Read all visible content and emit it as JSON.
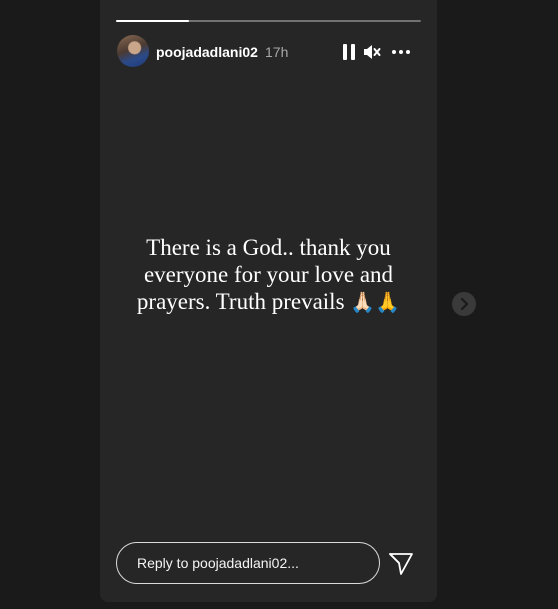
{
  "story": {
    "progress": 0.24,
    "username": "poojadadlani02",
    "timestamp": "17h",
    "text_lines": [
      "There is a God.. thank you",
      "everyone for your love and",
      "prayers. Truth prevails"
    ],
    "emoji": "🙏🏻🙏"
  },
  "controls": {
    "pause_icon": "pause-icon",
    "mute_icon": "muted-speaker-icon",
    "more_icon": "more-options-icon"
  },
  "navigation": {
    "next_icon": "chevron-right-icon"
  },
  "reply": {
    "placeholder": "Reply to poojadadlani02...",
    "send_icon": "send-icon"
  },
  "colors": {
    "background": "#1a1a1a",
    "story_bg": "#262626",
    "text": "#ffffff",
    "timestamp": "#a8a8a8"
  }
}
